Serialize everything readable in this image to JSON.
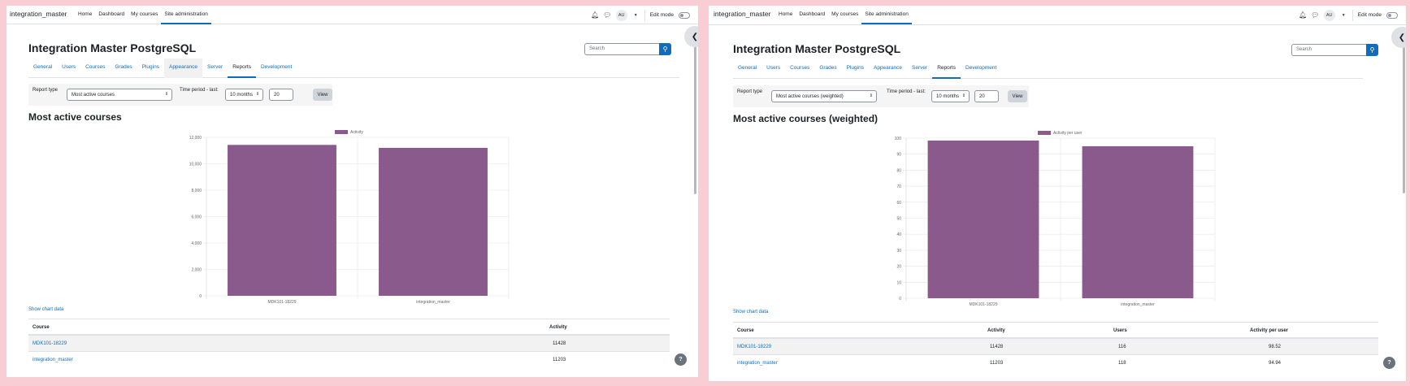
{
  "left": {
    "brand": "integration_master",
    "nav": [
      "Home",
      "Dashboard",
      "My courses",
      "Site administration"
    ],
    "avatar": "AU",
    "edit_mode": "Edit mode",
    "page_title": "Integration Master PostgreSQL",
    "search_placeholder": "Search",
    "tabs": [
      "General",
      "Users",
      "Courses",
      "Grades",
      "Plugins",
      "Appearance",
      "Server",
      "Reports",
      "Development"
    ],
    "form": {
      "report_type_label": "Report type",
      "report_type_value": "Most active courses",
      "time_label": "Time period - last:",
      "time_unit": "10 months",
      "time_value": "20",
      "view_label": "View"
    },
    "heading": "Most active courses",
    "show_chart_data": "Show chart data",
    "table": {
      "headers": [
        "Course",
        "Activity"
      ],
      "rows": [
        [
          "MDK101-18229",
          "11428"
        ],
        [
          "integration_master",
          "11203"
        ]
      ]
    }
  },
  "right": {
    "brand": "integration_master",
    "nav": [
      "Home",
      "Dashboard",
      "My courses",
      "Site administration"
    ],
    "avatar": "AU",
    "edit_mode": "Edit mode",
    "page_title": "Integration Master PostgreSQL",
    "search_placeholder": "Search",
    "tabs": [
      "General",
      "Users",
      "Courses",
      "Grades",
      "Plugins",
      "Appearance",
      "Server",
      "Reports",
      "Development"
    ],
    "form": {
      "report_type_label": "Report type",
      "report_type_value": "Most active courses (weighted)",
      "time_label": "Time period - last:",
      "time_unit": "10 months",
      "time_value": "20",
      "view_label": "View"
    },
    "heading": "Most active courses (weighted)",
    "show_chart_data": "Show chart data",
    "table": {
      "headers": [
        "Course",
        "Activity",
        "Users",
        "Activity per user"
      ],
      "rows": [
        [
          "MDK101-18229",
          "11428",
          "116",
          "98.52"
        ],
        [
          "integration_master",
          "11203",
          "118",
          "94.94"
        ]
      ]
    }
  },
  "colors": {
    "bar": "#8b5a8c",
    "link": "#0f6cbf"
  },
  "chart_data": [
    {
      "type": "bar",
      "categories": [
        "MDK101-18229",
        "integration_master"
      ],
      "series": [
        {
          "name": "Activity",
          "values": [
            11428,
            11203
          ]
        }
      ],
      "ylim": [
        0,
        12000
      ],
      "yticks": [
        0,
        2000,
        4000,
        6000,
        8000,
        10000,
        12000
      ],
      "ytick_labels": [
        "0",
        "2,000",
        "4,000",
        "6,000",
        "8,000",
        "10,000",
        "12,000"
      ],
      "legend": "top"
    },
    {
      "type": "bar",
      "categories": [
        "MDK101-18229",
        "integration_master"
      ],
      "series": [
        {
          "name": "Activity per user",
          "values": [
            98.52,
            94.94
          ]
        }
      ],
      "ylim": [
        0,
        100
      ],
      "yticks": [
        0,
        10,
        20,
        30,
        40,
        50,
        60,
        70,
        80,
        90,
        100
      ],
      "ytick_labels": [
        "0",
        "10",
        "20",
        "30",
        "40",
        "50",
        "60",
        "70",
        "80",
        "90",
        "100"
      ],
      "legend": "top"
    }
  ]
}
